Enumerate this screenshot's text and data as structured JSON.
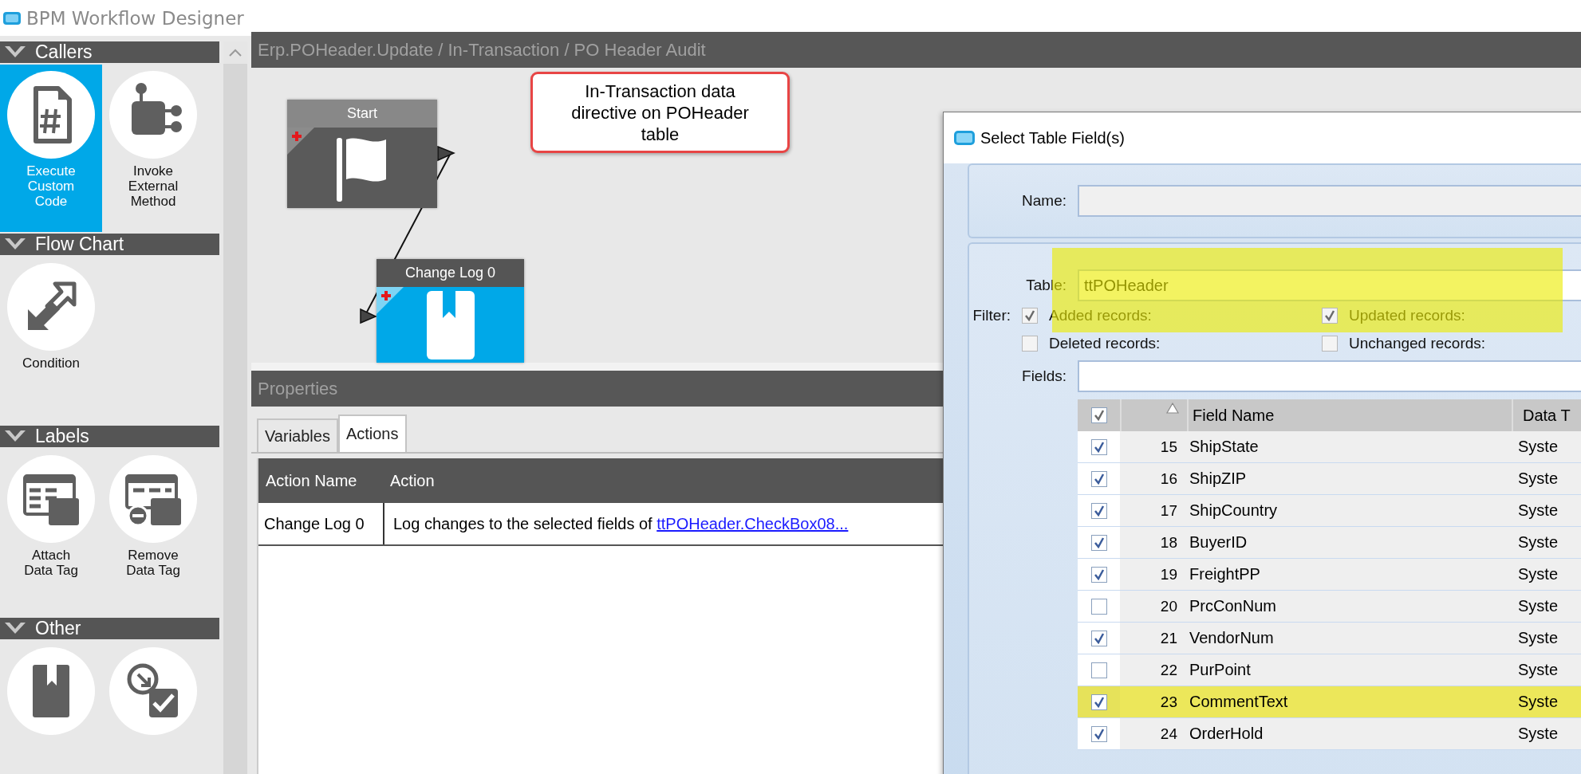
{
  "window": {
    "title": "BPM Workflow Designer"
  },
  "palette": {
    "sections": [
      {
        "title": "Callers",
        "expanded": true,
        "items": [
          {
            "kind": "custom-code",
            "label": "Execute Custom Code",
            "selected": true
          },
          {
            "kind": "external-method",
            "label": "Invoke External Method",
            "selected": false
          }
        ]
      },
      {
        "title": "Flow Chart",
        "expanded": true,
        "items": [
          {
            "kind": "condition",
            "label": "Condition",
            "selected": false
          }
        ]
      },
      {
        "title": "Labels",
        "expanded": true,
        "items": [
          {
            "kind": "attach-tag",
            "label": "Attach Data Tag",
            "selected": false
          },
          {
            "kind": "remove-tag",
            "label": "Remove Data Tag",
            "selected": false
          }
        ]
      },
      {
        "title": "Other",
        "expanded": true,
        "items": [
          {
            "kind": "book",
            "selected": false
          },
          {
            "kind": "checkbox-arrow",
            "selected": false
          }
        ]
      }
    ]
  },
  "breadcrumb": "Erp.POHeader.Update / In-Transaction / PO Header Audit",
  "canvas": {
    "nodes": [
      {
        "kind": "start",
        "title": "Start",
        "selected": false
      },
      {
        "kind": "change-log",
        "title": "Change Log 0",
        "selected": true
      }
    ],
    "callout": "In-Transaction data directive on POHeader table"
  },
  "properties": {
    "title": "Properties",
    "tabs": [
      {
        "label": "Variables",
        "selected": false
      },
      {
        "label": "Actions",
        "selected": true
      }
    ],
    "columns": [
      "Action Name",
      "Action"
    ],
    "rows": [
      {
        "name": "Change Log 0",
        "action": "Log changes to the selected fields of ",
        "link": "ttPOHeader.CheckBox08..."
      }
    ]
  },
  "dialog": {
    "title": "Select Table Field(s)",
    "name_label": "Name:",
    "table_label": "Table:",
    "table_value": "ttPOHeader",
    "filter_label": "Filter:",
    "filter_highlighted": true,
    "filters": [
      {
        "label": "Added records:",
        "checked": true,
        "disabled": true
      },
      {
        "label": "Updated records:",
        "checked": true,
        "disabled": true
      },
      {
        "label": "Deleted records:",
        "checked": false,
        "disabled": true
      },
      {
        "label": "Unchanged records:",
        "checked": false,
        "disabled": true
      }
    ],
    "fields_label": "Fields:",
    "grid": {
      "all_checked": true,
      "columns": [
        "Field Name",
        "Data T"
      ],
      "rows": [
        {
          "number": "15",
          "name": "ShipState",
          "type": "Syste",
          "checked": true,
          "highlighted": false
        },
        {
          "number": "16",
          "name": "ShipZIP",
          "type": "Syste",
          "checked": true,
          "highlighted": false
        },
        {
          "number": "17",
          "name": "ShipCountry",
          "type": "Syste",
          "checked": true,
          "highlighted": false
        },
        {
          "number": "18",
          "name": "BuyerID",
          "type": "Syste",
          "checked": true,
          "highlighted": false
        },
        {
          "number": "19",
          "name": "FreightPP",
          "type": "Syste",
          "checked": true,
          "highlighted": false
        },
        {
          "number": "20",
          "name": "PrcConNum",
          "type": "Syste",
          "checked": false,
          "highlighted": false
        },
        {
          "number": "21",
          "name": "VendorNum",
          "type": "Syste",
          "checked": true,
          "highlighted": false
        },
        {
          "number": "22",
          "name": "PurPoint",
          "type": "Syste",
          "checked": false,
          "highlighted": false
        },
        {
          "number": "23",
          "name": "CommentText",
          "type": "Syste",
          "checked": true,
          "highlighted": true
        },
        {
          "number": "24",
          "name": "OrderHold",
          "type": "Syste",
          "checked": true,
          "highlighted": false
        }
      ]
    }
  }
}
